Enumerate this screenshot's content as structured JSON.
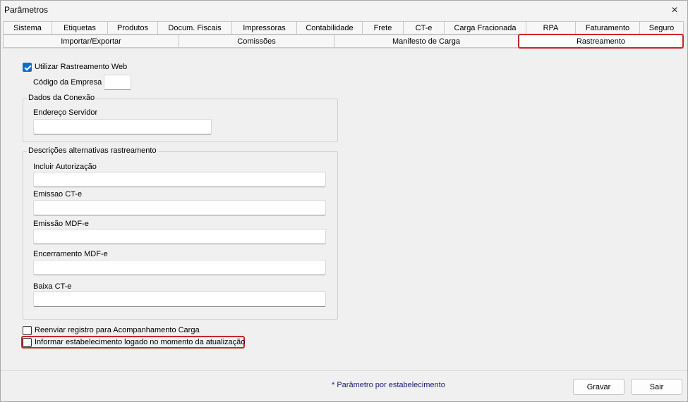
{
  "window": {
    "title": "Parâmetros",
    "close_icon": "×"
  },
  "tabs_row1": [
    {
      "label": "Sistema",
      "w": 70
    },
    {
      "label": "Etiquetas",
      "w": 80
    },
    {
      "label": "Produtos",
      "w": 72
    },
    {
      "label": "Docum. Fiscais",
      "w": 106
    },
    {
      "label": "Impressoras",
      "w": 93
    },
    {
      "label": "Contabilidade",
      "w": 94
    },
    {
      "label": "Frete",
      "w": 59
    },
    {
      "label": "CT-e",
      "w": 59
    },
    {
      "label": "Carga Fracionada",
      "w": 117
    },
    {
      "label": "RPA",
      "w": 71
    },
    {
      "label": "Faturamento",
      "w": 92
    },
    {
      "label": "Seguro",
      "w": 63
    }
  ],
  "tabs_row2": [
    {
      "label": "Importar/Exportar",
      "w": 250
    },
    {
      "label": "Comissões",
      "w": 221
    },
    {
      "label": "Manifesto de Carga",
      "w": 262
    },
    {
      "label": "Rastreamento",
      "w": 235,
      "active": true
    }
  ],
  "form": {
    "use_web_tracking": {
      "label": "Utilizar Rastreamento Web",
      "checked": true
    },
    "company_code": {
      "label": "Código da Empresa",
      "value": ""
    },
    "connection_group": {
      "title": "Dados da Conexão",
      "server_address": {
        "label": "Endereço Servidor",
        "value": ""
      }
    },
    "descriptions_group": {
      "title": "Descrições alternativas rastreamento",
      "fields": [
        {
          "label": "Incluir Autorização",
          "value": ""
        },
        {
          "label": "Emissao CT-e",
          "value": ""
        },
        {
          "label": "Emissão MDF-e",
          "value": ""
        },
        {
          "label": "Encerramento MDF-e",
          "value": ""
        },
        {
          "label": "Baixa CT-e",
          "value": ""
        }
      ]
    },
    "resend_tracking": {
      "label": "Reenviar registro para Acompanhamento Carga",
      "checked": false
    },
    "inform_establishment": {
      "label": "Informar estabelecimento logado no momento da atualização",
      "checked": false
    }
  },
  "footer": {
    "note": "* Parâmetro por estabelecimento",
    "save_label": "Gravar",
    "exit_label": "Sair"
  }
}
